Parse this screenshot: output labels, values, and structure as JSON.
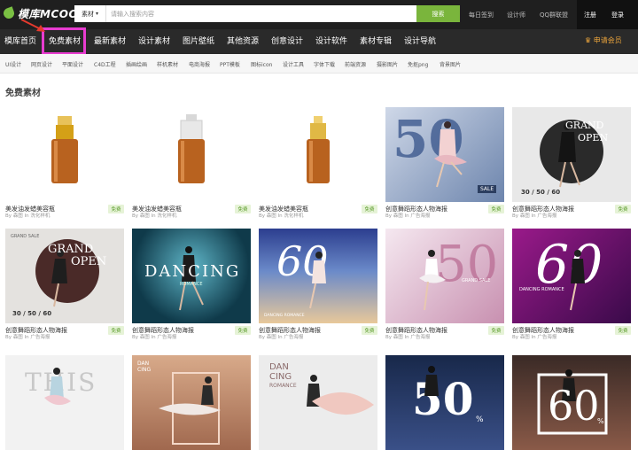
{
  "header": {
    "logo_text": "模库MCOOL",
    "search_category": "素材",
    "search_placeholder": "请输入搜索内容",
    "search_button": "搜索",
    "links": [
      "每日签到",
      "设计师",
      "QQ群联盟"
    ],
    "register": "注册",
    "login": "登录"
  },
  "nav": {
    "items": [
      "模库首页",
      "免费素材",
      "最新素材",
      "设计素材",
      "图片壁纸",
      "其他资源",
      "创意设计",
      "设计软件",
      "素材专辑",
      "设计导航"
    ],
    "vip": "申请会员"
  },
  "subnav": {
    "items": [
      "UI设计",
      "网页设计",
      "平面设计",
      "C4D工程",
      "插画绘画",
      "样机素材",
      "电商海报",
      "PPT模板",
      "图标icon",
      "设计工具",
      "字体下载",
      "前端资源",
      "摄影图片",
      "免抠png",
      "背景图片"
    ]
  },
  "section": {
    "title": "免费素材"
  },
  "cards": [
    {
      "title": "美发油发蜡美容瓶",
      "meta": "By 森图 In 洗化样机",
      "badge": "免费"
    },
    {
      "title": "美发油发蜡美容瓶",
      "meta": "By 森图 In 洗化样机",
      "badge": "免费"
    },
    {
      "title": "美发油发蜡美容瓶",
      "meta": "By 森图 In 洗化样机",
      "badge": "免费"
    },
    {
      "title": "创意舞蹈形态人物海报",
      "meta": "By 森图 In 广告海报",
      "badge": "免费"
    },
    {
      "title": "创意舞蹈形态人物海报",
      "meta": "By 森图 In 广告海报",
      "badge": "免费"
    },
    {
      "title": "创意舞蹈形态人物海报",
      "meta": "By 森图 In 广告海报",
      "badge": "免费"
    },
    {
      "title": "创意舞蹈形态人物海报",
      "meta": "By 森图 In 广告海报",
      "badge": "免费"
    },
    {
      "title": "创意舞蹈形态人物海报",
      "meta": "By 森图 In 广告海报",
      "badge": "免费"
    },
    {
      "title": "创意舞蹈形态人物海报",
      "meta": "By 森图 In 广告海报",
      "badge": "免费"
    },
    {
      "title": "创意舞蹈形态人物海报",
      "meta": "By 森图 In 广告海报",
      "badge": "免费"
    }
  ],
  "posters": {
    "p1": "50",
    "p1b": "SALE",
    "p2a": "GRAND",
    "p2b": "OPEN",
    "p2c": "30 / 50 / 60",
    "p3a": "GRAND",
    "p3b": "OPEN",
    "p3c": "30 / 50 / 60",
    "p3d": "GRAND SALE",
    "p4a": "DANCING",
    "p4b": "ROMANCE",
    "p5": "60",
    "p5b": "DANCING ROMANCE",
    "p6": "50",
    "p6b": "GRAND SALE",
    "p7": "60",
    "p7b": "DANCING ROMANCE",
    "p8": "THIS",
    "p9a": "DAN",
    "p9b": "CING",
    "p10a": "DAN",
    "p10b": "CING",
    "p10c": "ROMANCE",
    "p11": "50",
    "p11b": "%",
    "p12": "60",
    "p12b": "%"
  }
}
